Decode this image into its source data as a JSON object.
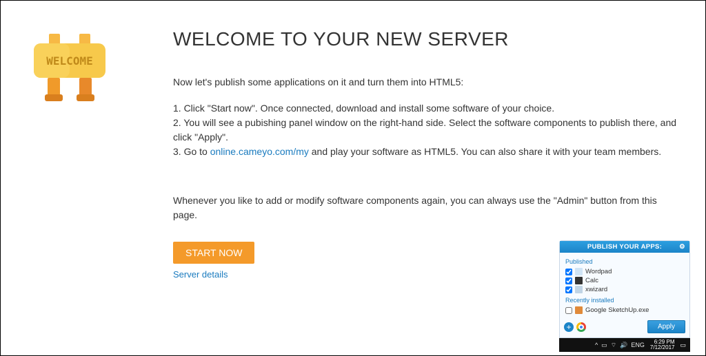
{
  "welcome_badge": "WELCOME",
  "title": "WELCOME TO YOUR NEW SERVER",
  "intro": "Now let's publish some applications on it and turn them into HTML5:",
  "steps": {
    "s1": "1. Click \"Start now\". Once connected, download and install some software of your choice.",
    "s2": "2. You will see a pubishing panel window on the right-hand side. Select the software components to publish there, and click \"Apply\".",
    "s3_prefix": "3. Go to ",
    "s3_link": "online.cameyo.com/my",
    "s3_suffix": " and play your software as HTML5. You can also share it with your team members."
  },
  "note": "Whenever you like to add or modify software components again, you can always use the \"Admin\" button from this page.",
  "start_button": "START NOW",
  "details_link": "Server details",
  "panel": {
    "header": "PUBLISH YOUR APPS:",
    "published_label": "Published",
    "apps": [
      {
        "name": "Wordpad",
        "checked": true
      },
      {
        "name": "Calc",
        "checked": true
      },
      {
        "name": "xwizard",
        "checked": true
      }
    ],
    "recent_label": "Recently installed",
    "recent": [
      {
        "name": "Google SketchUp.exe",
        "checked": false
      }
    ],
    "apply": "Apply"
  },
  "taskbar": {
    "lang": "ENG",
    "time": "6:29 PM",
    "date": "7/12/2017"
  }
}
